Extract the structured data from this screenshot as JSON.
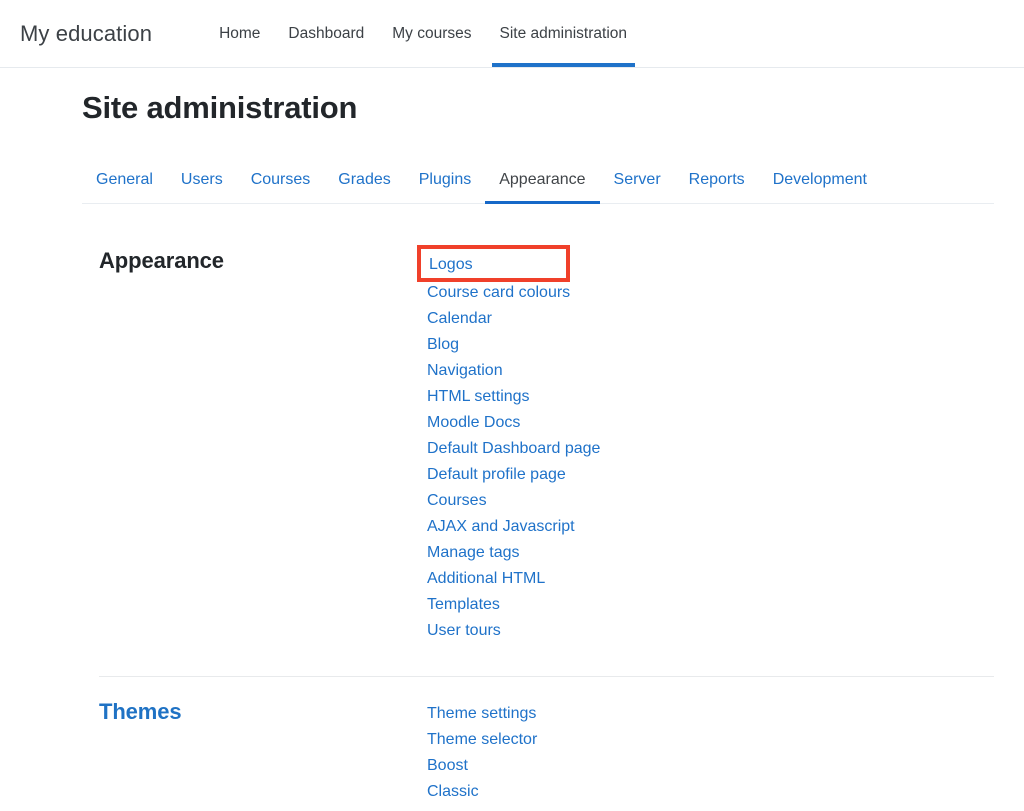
{
  "navbar": {
    "brand": "My education",
    "links": [
      {
        "label": "Home",
        "active": false
      },
      {
        "label": "Dashboard",
        "active": false
      },
      {
        "label": "My courses",
        "active": false
      },
      {
        "label": "Site administration",
        "active": true
      }
    ]
  },
  "page": {
    "title": "Site administration"
  },
  "tabs": [
    {
      "label": "General",
      "active": false
    },
    {
      "label": "Users",
      "active": false
    },
    {
      "label": "Courses",
      "active": false
    },
    {
      "label": "Grades",
      "active": false
    },
    {
      "label": "Plugins",
      "active": false
    },
    {
      "label": "Appearance",
      "active": true
    },
    {
      "label": "Server",
      "active": false
    },
    {
      "label": "Reports",
      "active": false
    },
    {
      "label": "Development",
      "active": false
    }
  ],
  "sections": [
    {
      "heading": "Appearance",
      "heading_color": "#22262a",
      "links": [
        "Logos",
        "Course card colours",
        "Calendar",
        "Blog",
        "Navigation",
        "HTML settings",
        "Moodle Docs",
        "Default Dashboard page",
        "Default profile page",
        "Courses",
        "AJAX and Javascript",
        "Manage tags",
        "Additional HTML",
        "Templates",
        "User tours"
      ]
    },
    {
      "heading": "Themes",
      "heading_color": "#1f72c4",
      "links": [
        "Theme settings",
        "Theme selector",
        "Boost",
        "Classic"
      ]
    }
  ],
  "annotation": {
    "highlight_target": "Logos",
    "highlight_color": "#f0402a",
    "highlight_style": "rectangle-outline"
  },
  "colors": {
    "link_blue": "#1f72c9",
    "active_tab_underline": "#1668c8",
    "text_dark": "#22262a",
    "divider": "#e8eaec",
    "background": "#ffffff"
  }
}
